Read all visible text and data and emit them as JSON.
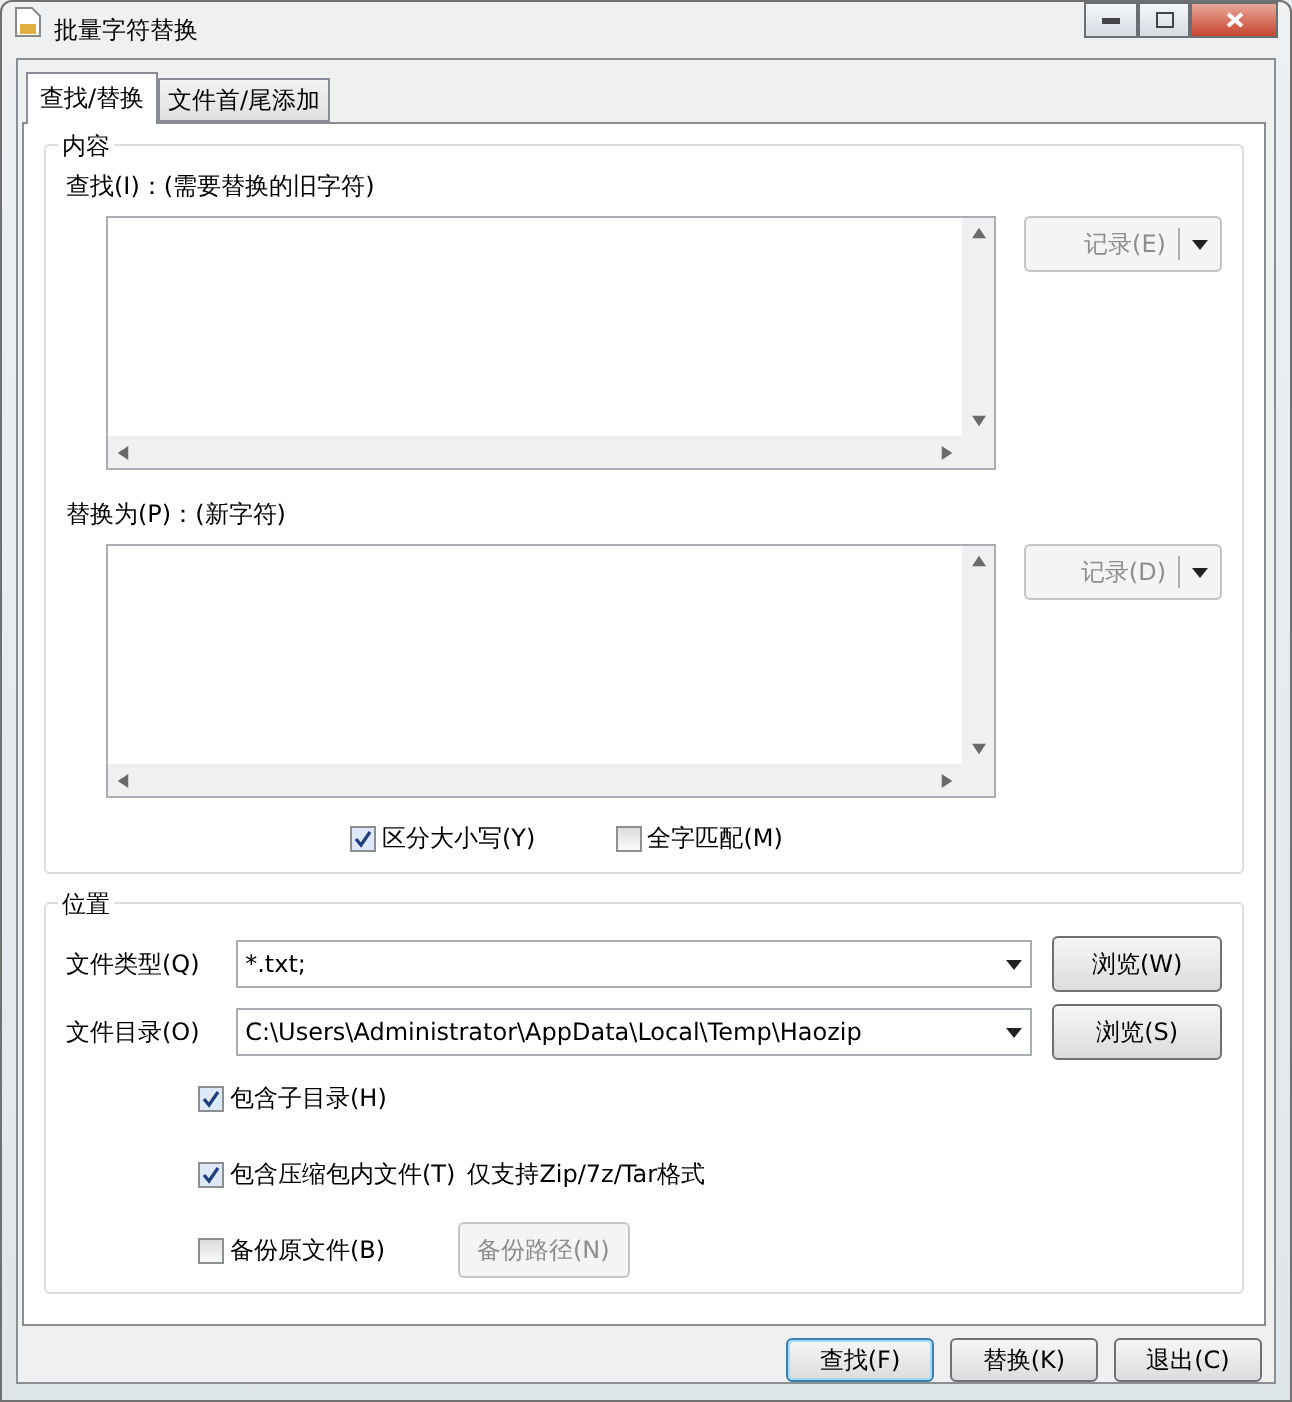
{
  "window": {
    "title": "批量字符替换"
  },
  "tabs": [
    {
      "label": "查找/替换",
      "selected": true
    },
    {
      "label": "文件首/尾添加",
      "selected": false
    }
  ],
  "content_group": {
    "title": "内容",
    "areas": [
      {
        "label": "查找(I)：(需要替换的旧字符)",
        "history_button": {
          "label": "记录(E)",
          "disabled": true
        }
      },
      {
        "label": "替换为(P)：(新字符)",
        "history_button": {
          "label": "记录(D)",
          "disabled": true
        }
      }
    ],
    "options": [
      {
        "label": "区分大小写(Y)",
        "checked": true
      },
      {
        "label": "全字匹配(M)",
        "checked": false
      }
    ]
  },
  "location_group": {
    "title": "位置",
    "fields": [
      {
        "label": "文件类型(Q)",
        "value": "*.txt;",
        "button": "浏览(W)"
      },
      {
        "label": "文件目录(O)",
        "value": "C:\\Users\\Administrator\\AppData\\Local\\Temp\\Haozip",
        "button": "浏览(S)"
      }
    ],
    "options": [
      {
        "label": "包含子目录(H)",
        "checked": true
      },
      {
        "label": "包含压缩包内文件(T)",
        "checked": true,
        "note": "仅支持Zip/7z/Tar格式"
      },
      {
        "label": "备份原文件(B)",
        "checked": false,
        "button": {
          "label": "备份路径(N)",
          "disabled": true
        }
      }
    ]
  },
  "buttons": [
    {
      "label": "查找(F)",
      "default": true
    },
    {
      "label": "替换(K)",
      "default": false
    },
    {
      "label": "退出(C)",
      "default": false
    }
  ]
}
